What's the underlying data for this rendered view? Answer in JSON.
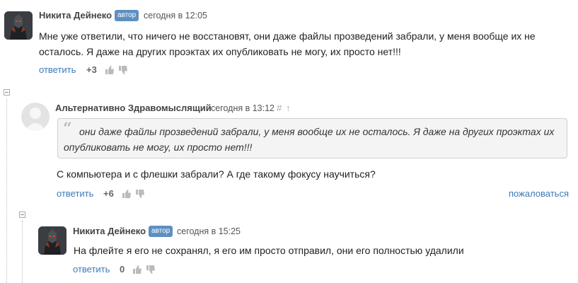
{
  "comments": [
    {
      "author": "Никита Дейнеко",
      "badge": "автор",
      "time": "сегодня в 12:05",
      "text": "Мне уже ответили, что ничего не восстановят, они даже файлы прозведений забрали, у меня вообще их не осталось. Я даже на других проэктах их опубликовать не могу, их просто нет!!!",
      "reply_label": "ответить",
      "score": "+3"
    },
    {
      "author": "Альтернативно Здравомыслящий",
      "time": "сегодня в 13:12",
      "hash": "#",
      "up_arrow": "↑",
      "quote_mark": "“",
      "quote": "они даже файлы прозведений забрали, у меня вообще их не осталось. Я даже на других проэктах их опубликовать не могу, их просто нет!!!",
      "text": "С компьютера и с флешки забрали? А где такому фокусу научиться?",
      "reply_label": "ответить",
      "score": "+6",
      "complain_label": "пожаловаться"
    },
    {
      "author": "Никита Дейнеко",
      "badge": "автор",
      "time": "сегодня в 15:25",
      "text": "На флейте я его не сохранял, я его им просто отправил, они его полностью удалили",
      "reply_label": "ответить",
      "score": "0"
    }
  ],
  "icons": {
    "thumb_up": "thumb-up-icon",
    "thumb_down": "thumb-down-icon",
    "collapse": "collapse-minus-icon"
  },
  "colors": {
    "link": "#3d7ab8",
    "badge": "#5e8fc1",
    "quote_bg": "#f4f4f4"
  }
}
